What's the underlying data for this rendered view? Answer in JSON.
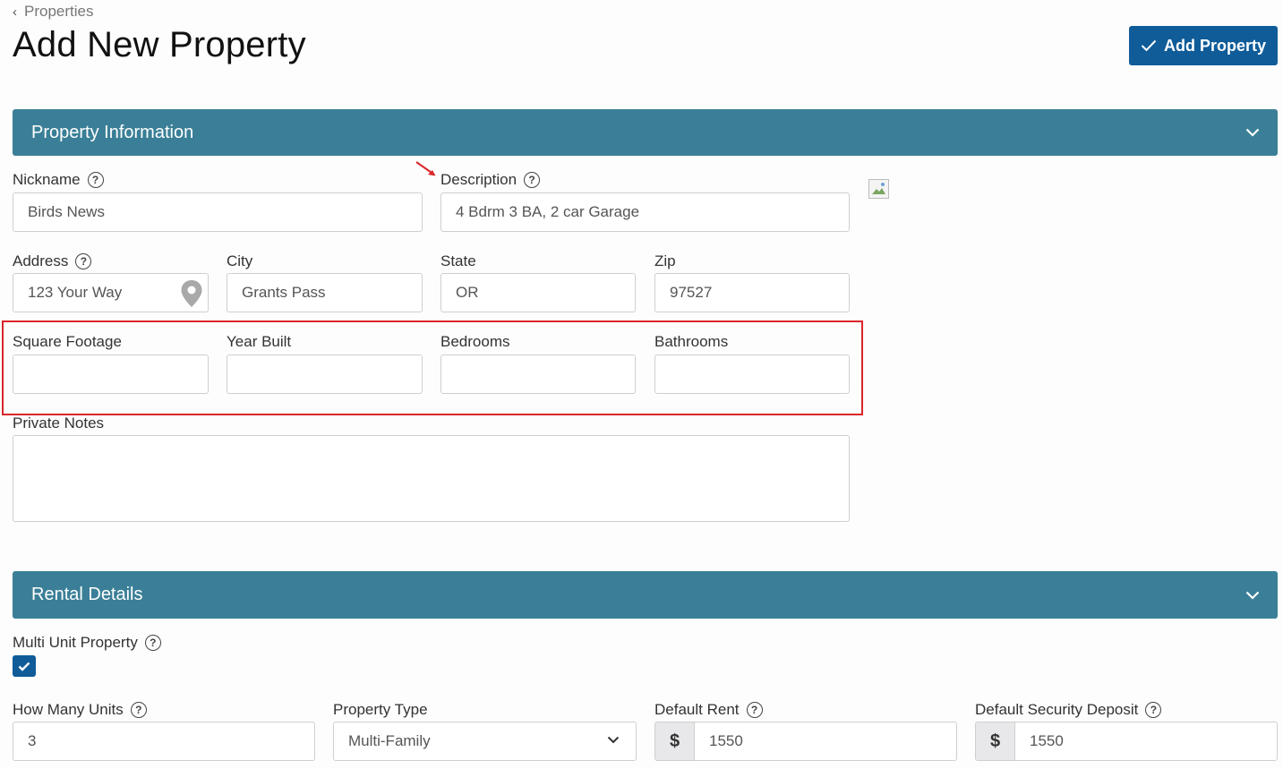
{
  "breadcrumb": {
    "label": "Properties"
  },
  "page": {
    "title": "Add New Property"
  },
  "actions": {
    "add_property": "Add Property"
  },
  "sections": {
    "property_info": "Property Information",
    "rental_details": "Rental Details"
  },
  "fields": {
    "nickname": {
      "label": "Nickname",
      "value": "Birds News"
    },
    "description": {
      "label": "Description",
      "value": "4 Bdrm 3 BA, 2 car Garage"
    },
    "address": {
      "label": "Address",
      "value": "123 Your Way"
    },
    "city": {
      "label": "City",
      "value": "Grants Pass"
    },
    "state": {
      "label": "State",
      "value": "OR"
    },
    "zip": {
      "label": "Zip",
      "value": "97527"
    },
    "square_footage": {
      "label": "Square Footage",
      "value": ""
    },
    "year_built": {
      "label": "Year Built",
      "value": ""
    },
    "bedrooms": {
      "label": "Bedrooms",
      "value": ""
    },
    "bathrooms": {
      "label": "Bathrooms",
      "value": ""
    },
    "private_notes": {
      "label": "Private Notes",
      "value": ""
    }
  },
  "rental": {
    "multi_unit": {
      "label": "Multi Unit Property",
      "checked": true
    },
    "units": {
      "label": "How Many Units",
      "value": "3"
    },
    "property_type": {
      "label": "Property Type",
      "value": "Multi-Family"
    },
    "default_rent": {
      "label": "Default Rent",
      "prefix": "$",
      "value": "1550"
    },
    "security_deposit": {
      "label": "Default Security Deposit",
      "prefix": "$",
      "value": "1550"
    }
  },
  "help_glyph": "?",
  "colors": {
    "primary": "#0f5c99",
    "section_bar": "#3a7f97",
    "annotation_red": "#d9262b"
  }
}
